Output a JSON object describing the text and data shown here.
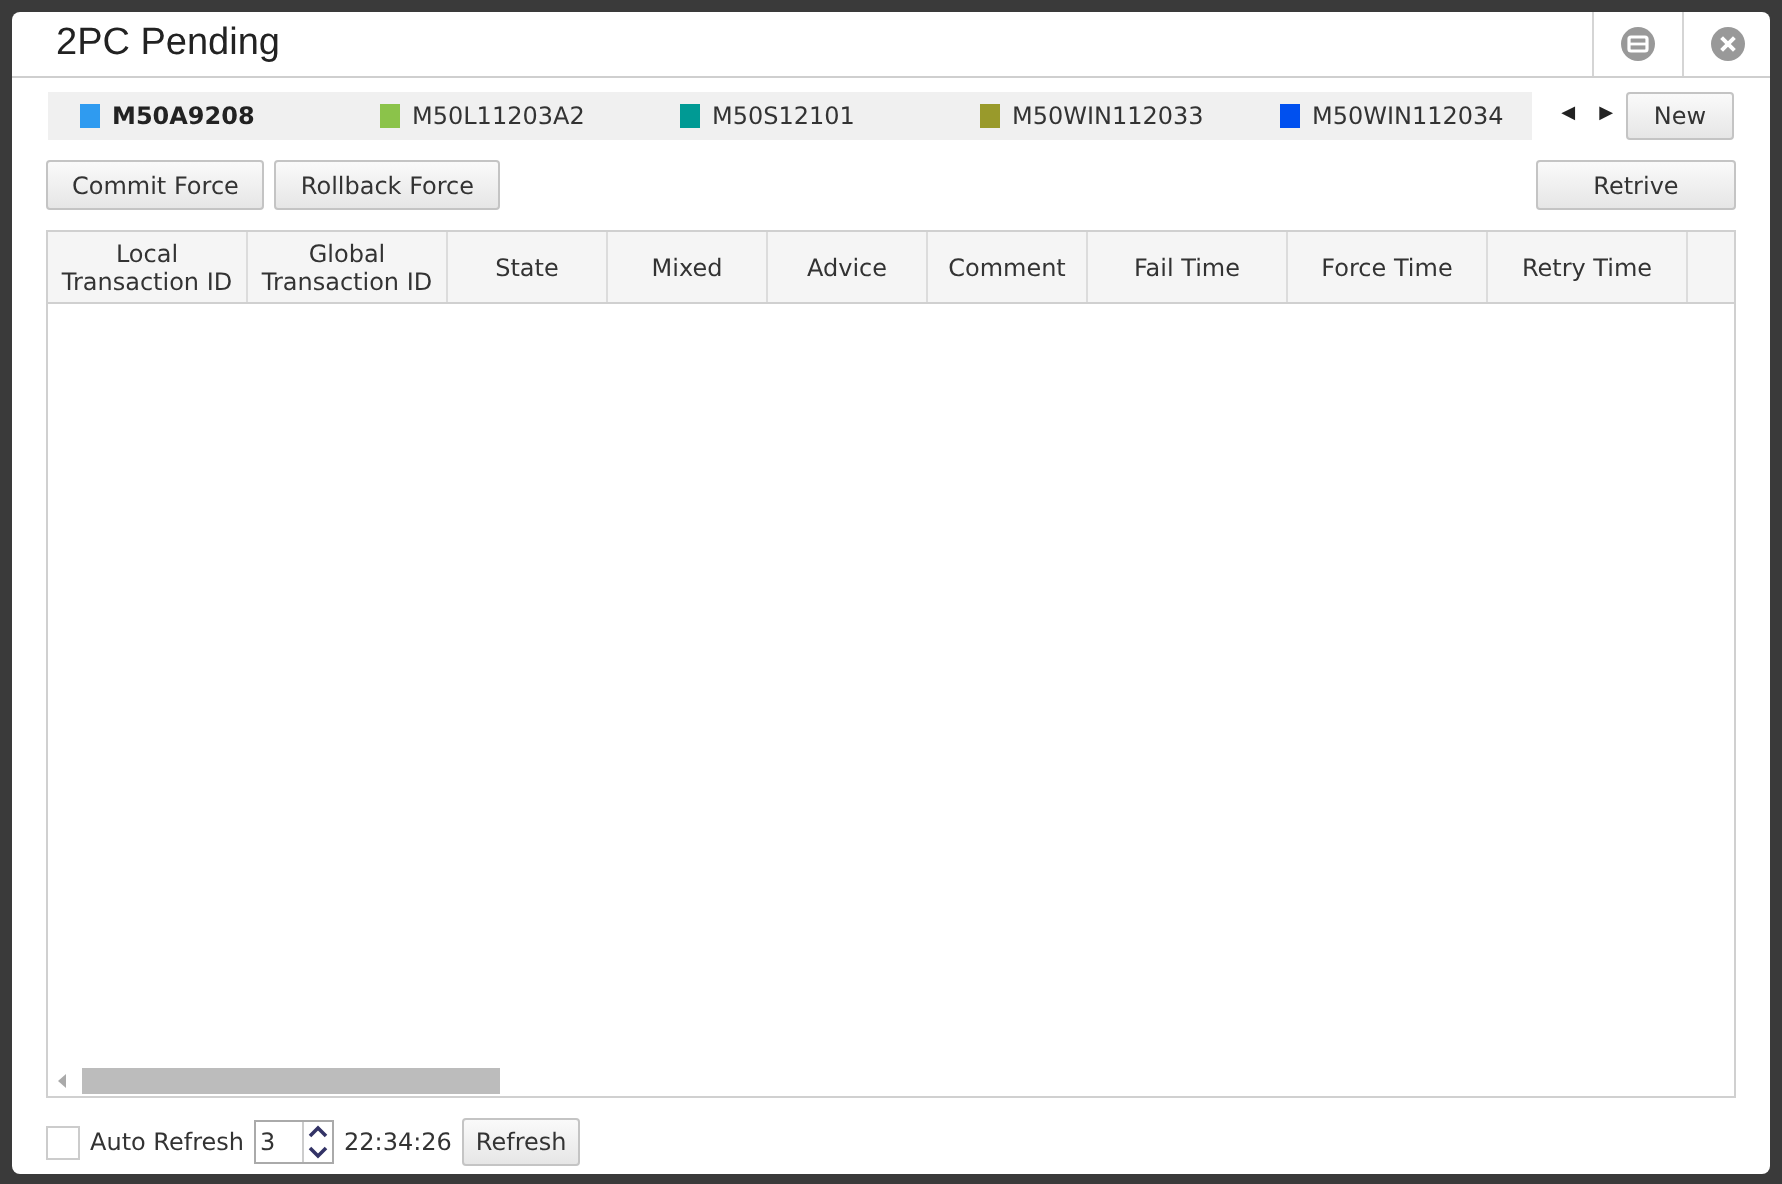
{
  "window": {
    "title": "2PC Pending"
  },
  "tabs": [
    {
      "label": "M50A9208",
      "selected": true,
      "color": "#2f9bf0"
    },
    {
      "label": "M50L11203A2",
      "selected": false,
      "color": "#8bc34a"
    },
    {
      "label": "M50S12101",
      "selected": false,
      "color": "#009a94"
    },
    {
      "label": "M50WIN112033",
      "selected": false,
      "color": "#999a2b"
    },
    {
      "label": "M50WIN112034",
      "selected": false,
      "color": "#0050ef"
    }
  ],
  "tab_nav": {
    "prev": "◀",
    "next": "▶"
  },
  "new_button": "New",
  "actions": [
    "Commit Force",
    "Rollback Force"
  ],
  "retrieve_button": "Retrive",
  "table": {
    "columns": [
      "Local\nTransaction ID",
      "Global\nTransaction ID",
      "State",
      "Mixed",
      "Advice",
      "Comment",
      "Fail Time",
      "Force Time",
      "Retry Time"
    ]
  },
  "footer": {
    "auto_refresh": {
      "label": "Auto Refresh",
      "checked": false
    },
    "interval": "3",
    "time": "22:34:26",
    "refresh_button": "Refresh"
  }
}
